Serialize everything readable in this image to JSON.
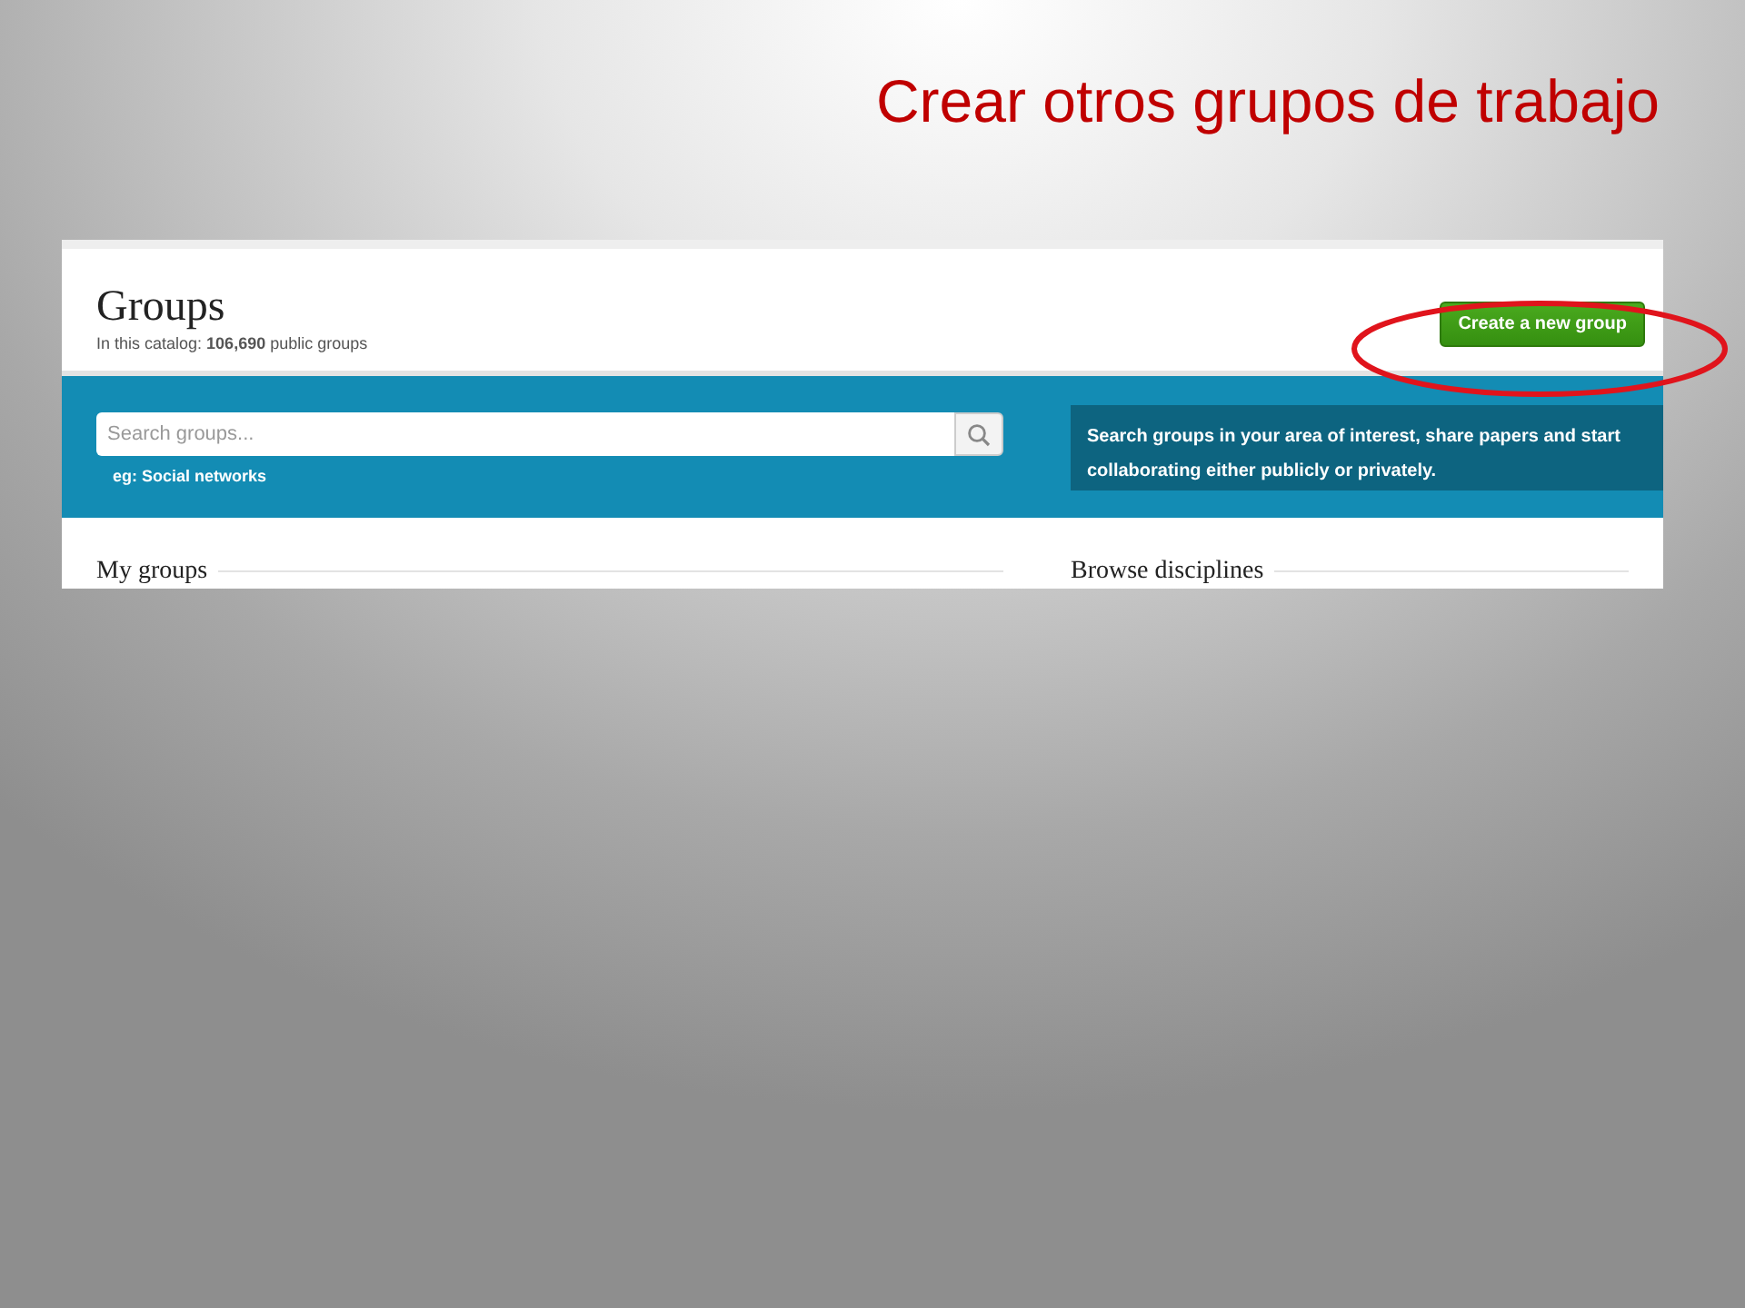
{
  "slide_title": "Crear otros grupos de trabajo",
  "page": {
    "title": "Groups",
    "subtitle": "In this catalog: **106,690** public groups",
    "create_button": "Create a new group",
    "search": {
      "placeholder": "Search groups...",
      "example": "eg: Social networks"
    },
    "info_text": "Search groups in your area of interest, share papers and start collaborating either publicly or privately.",
    "sections": [
      "My groups",
      "Browse disciplines"
    ]
  }
}
